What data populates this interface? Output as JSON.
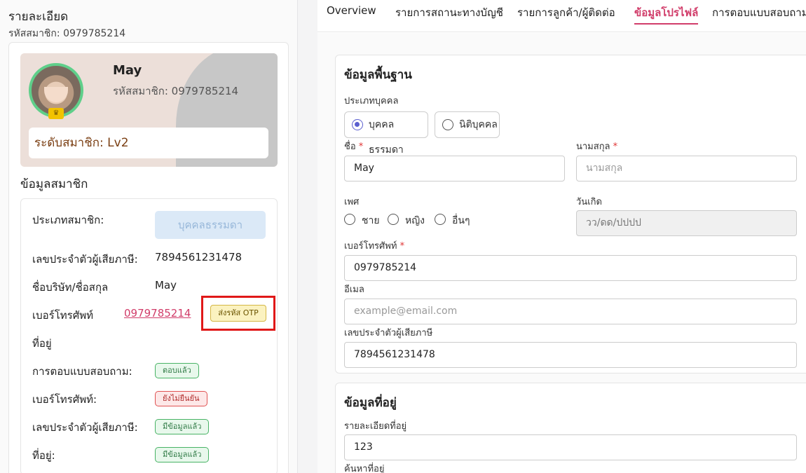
{
  "left": {
    "title": "รายละเอียด",
    "member_code_line": "รหัสสมาชิก: 0979785214",
    "profile": {
      "name": "May",
      "code_line": "รหัสสมาชิก: 0979785214",
      "crown_icon": "♛",
      "level_line": "ระดับสมาชิก: Lv2"
    },
    "member_section_title": "ข้อมูลสมาชิก",
    "rows": {
      "member_type_label": "ประเภทสมาชิก:",
      "member_type_value": "บุคคลธรรมดา",
      "tax_id_label": "เลขประจำตัวผู้เสียภาษี:",
      "tax_id_value": "7894561231478",
      "company_label": "ชื่อบริษัท/ชื่อสกุล",
      "company_value": "May",
      "phone_label": "เบอร์โทรศัพท์",
      "phone_value": "0979785214",
      "otp_label": "ส่งรหัส OTP",
      "address_label": "ที่อยู่",
      "survey_label": "การตอบแบบสอบถาม:",
      "survey_badge": "ตอบแล้ว",
      "phone_status_label": "เบอร์โทรศัพท์:",
      "phone_status_badge": "ยังไม่ยืนยัน",
      "tax_status_label": "เลขประจำตัวผู้เสียภาษี:",
      "tax_status_badge": "มีข้อมูลแล้ว",
      "address_status_label": "ที่อยู่:",
      "address_status_badge": "มีข้อมูลแล้ว"
    }
  },
  "tabs": [
    "Overview",
    "รายการสถานะทางบัญชี",
    "รายการลูกค้า/ผู้ติดต่อ",
    "ข้อมูลโปรไฟล์",
    "การตอบแบบสอบถาม"
  ],
  "active_tab": "ข้อมูลโปรไฟล์",
  "basic": {
    "title": "ข้อมูลพื้นฐาน",
    "person_type_label": "ประเภทบุคคล",
    "person_type_options": [
      "บุคคลธรรมดา",
      "นิติบุคคล"
    ],
    "person_type_selected": "บุคคลธรรมดา",
    "first_name_label": "ชื่อ",
    "first_name_value": "May",
    "last_name_label": "นามสกุล",
    "last_name_placeholder": "นามสกุล",
    "required_mark": "*",
    "gender_label": "เพศ",
    "gender_options": [
      "ชาย",
      "หญิง",
      "อื่นๆ"
    ],
    "birthday_label": "วันเกิด",
    "birthday_placeholder": "วว/ดด/ปปปป",
    "phone_label": "เบอร์โทรศัพท์",
    "phone_value": "0979785214",
    "email_label": "อีเมล",
    "email_placeholder": "example@email.com",
    "tax_label": "เลขประจำตัวผู้เสียภาษี",
    "tax_value": "7894561231478"
  },
  "address": {
    "title": "ข้อมูลที่อยู่",
    "detail_label": "รายละเอียดที่อยู่",
    "detail_value": "123",
    "search_label": "ค้นหาที่อยู่"
  }
}
